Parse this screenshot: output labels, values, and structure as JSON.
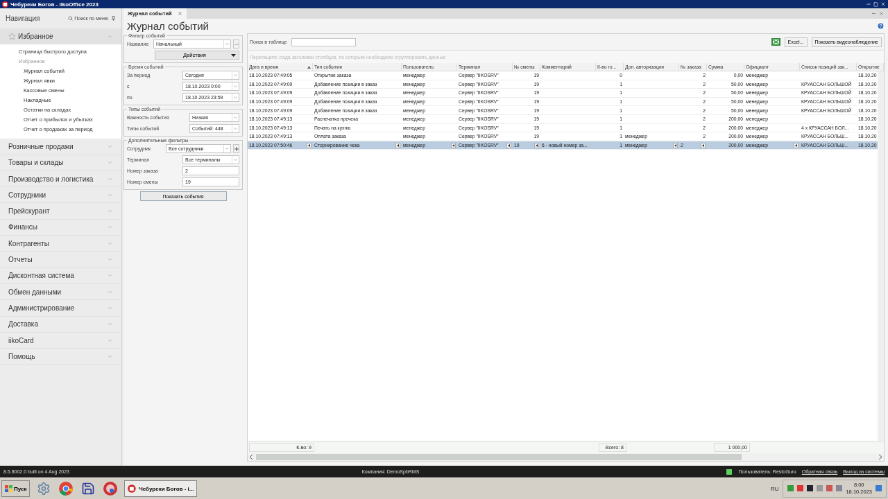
{
  "window": {
    "title": "Чебуреки Богов - iikoOffice 2023"
  },
  "navigation": {
    "title": "Навигация",
    "search": "Поиск по меню",
    "sections": [
      {
        "label": "Избранное",
        "expanded": true,
        "children": [
          {
            "label": "Страница быстрого доступа",
            "kind": "link"
          },
          {
            "label": "Избранное",
            "kind": "group",
            "children": [
              {
                "label": "Журнал событий"
              },
              {
                "label": "Журнал явки"
              },
              {
                "label": "Кассовые смены"
              },
              {
                "label": "Накладные"
              },
              {
                "label": "Остатки на складах"
              },
              {
                "label": "Отчет о прибылях и убытках"
              },
              {
                "label": "Отчет о продажах за период"
              }
            ]
          }
        ]
      },
      {
        "label": "Розничные продажи",
        "expanded": false
      },
      {
        "label": "Товары и склады",
        "expanded": false
      },
      {
        "label": "Производство и логистика",
        "expanded": false
      },
      {
        "label": "Сотрудники",
        "expanded": false
      },
      {
        "label": "Прейскурант",
        "expanded": false
      },
      {
        "label": "Финансы",
        "expanded": false
      },
      {
        "label": "Контрагенты",
        "expanded": false
      },
      {
        "label": "Отчеты",
        "expanded": false
      },
      {
        "label": "Дисконтная система",
        "expanded": false
      },
      {
        "label": "Обмен данными",
        "expanded": false
      },
      {
        "label": "Администрирование",
        "expanded": false
      },
      {
        "label": "Доставка",
        "expanded": false
      },
      {
        "label": "iikoCard",
        "expanded": false
      },
      {
        "label": "Помощь",
        "expanded": false
      }
    ]
  },
  "tabs": [
    {
      "label": "Журнал событий",
      "selected": true
    }
  ],
  "page_title": "Журнал событий",
  "filter": {
    "title": "Фильтр событий",
    "name_label": "Название",
    "name_value": "Начальный",
    "actions": "Действия",
    "groups": [
      {
        "title": "Время событий",
        "rows": [
          {
            "label": "За период",
            "value": "Сегодня",
            "kind": "combo"
          },
          {
            "label": "с",
            "value": "18.10.2023 0:00",
            "kind": "combo"
          },
          {
            "label": "по",
            "value": "18.10.2023 23:59",
            "kind": "combo"
          }
        ]
      },
      {
        "title": "Типы событий",
        "rows": [
          {
            "label": "Важность события",
            "value": "Низкая",
            "kind": "combo"
          },
          {
            "label": "Типы событий",
            "value": "Событий: 448",
            "kind": "combo"
          }
        ]
      },
      {
        "title": "Дополнительные фильтры",
        "rows": [
          {
            "label": "Сотрудник",
            "value": "Все сотрудники",
            "kind": "combo_add"
          },
          {
            "label": "Терминал",
            "value": "Все терминалы",
            "kind": "combo"
          },
          {
            "label": "Номер заказа",
            "value": "2",
            "kind": "text"
          },
          {
            "label": "Номер смены",
            "value": "19",
            "kind": "text"
          }
        ]
      }
    ],
    "show_button": "Показать события"
  },
  "grid": {
    "search_label": "Поиск в таблице",
    "excel_button": "Excel...",
    "video_button": "Показать видеонаблюдение",
    "group_hint": "Перетащите сюда заголовки столбцов, по которым необходимо сгруппировать данные",
    "columns": [
      {
        "label": "Дата и время",
        "kind": "text",
        "sorted": true,
        "filter_button": true
      },
      {
        "label": "Тип события",
        "kind": "text",
        "sorted": false,
        "filter_button": true
      },
      {
        "label": "Пользователь",
        "kind": "text",
        "sorted": false,
        "filter_button": true
      },
      {
        "label": "Терминал",
        "kind": "text",
        "sorted": false,
        "filter_button": true
      },
      {
        "label": "№ смены",
        "kind": "number",
        "sorted": false,
        "filter_button": true
      },
      {
        "label": "Комментарий",
        "kind": "text",
        "sorted": false,
        "filter_button": false
      },
      {
        "label": "К-во го...",
        "kind": "number",
        "sorted": false,
        "filter_button": false
      },
      {
        "label": "Доп. авторизация",
        "kind": "text",
        "sorted": false,
        "filter_button": true
      },
      {
        "label": "№ заказа",
        "kind": "number",
        "sorted": false,
        "filter_button": true
      },
      {
        "label": "Сумма",
        "kind": "number",
        "sorted": false,
        "filter_button": false
      },
      {
        "label": "Официант",
        "kind": "text",
        "sorted": false,
        "filter_button": true
      },
      {
        "label": "Список позиций зак...",
        "kind": "text",
        "sorted": false,
        "filter_button": false
      },
      {
        "label": "Открытие",
        "kind": "text",
        "sorted": false,
        "filter_button": false
      }
    ],
    "rows": [
      {
        "selected": false,
        "cells": [
          "18.10.2023 07:49:05",
          "Открытие заказа",
          "менеджер",
          "Сервер \"IIKOSRV\"",
          "19",
          "",
          "0",
          "",
          "2",
          "0,00",
          "менеджер",
          "",
          "18.10.20"
        ]
      },
      {
        "selected": false,
        "cells": [
          "18.10.2023 07:49:09",
          "Добавление позиции в заказ",
          "менеджер",
          "Сервер \"IIKOSRV\"",
          "19",
          "",
          "1",
          "",
          "2",
          "50,00",
          "менеджер",
          "КРУАССАН БОЛЬШОЙ",
          "18.10.20"
        ]
      },
      {
        "selected": false,
        "cells": [
          "18.10.2023 07:49:09",
          "Добавление позиции в заказ",
          "менеджер",
          "Сервер \"IIKOSRV\"",
          "19",
          "",
          "1",
          "",
          "2",
          "50,00",
          "менеджер",
          "КРУАССАН БОЛЬШОЙ",
          "18.10.20"
        ]
      },
      {
        "selected": false,
        "cells": [
          "18.10.2023 07:49:09",
          "Добавление позиции в заказ",
          "менеджер",
          "Сервер \"IIKOSRV\"",
          "19",
          "",
          "1",
          "",
          "2",
          "50,00",
          "менеджер",
          "КРУАССАН БОЛЬШОЙ",
          "18.10.20"
        ]
      },
      {
        "selected": false,
        "cells": [
          "18.10.2023 07:49:09",
          "Добавление позиции в заказ",
          "менеджер",
          "Сервер \"IIKOSRV\"",
          "19",
          "",
          "1",
          "",
          "2",
          "50,00",
          "менеджер",
          "КРУАССАН БОЛЬШОЙ",
          "18.10.20"
        ]
      },
      {
        "selected": false,
        "cells": [
          "18.10.2023 07:49:13",
          "Распечатка пречека",
          "менеджер",
          "Сервер \"IIKOSRV\"",
          "19",
          "",
          "1",
          "",
          "2",
          "200,00",
          "менеджер",
          "",
          "18.10.20"
        ]
      },
      {
        "selected": false,
        "cells": [
          "18.10.2023 07:49:13",
          "Печать на кухню",
          "менеджер",
          "Сервер \"IIKOSRV\"",
          "19",
          "",
          "1",
          "",
          "2",
          "200,00",
          "менеджер",
          "4 x КРУАССАН БОЛ...",
          "18.10.20"
        ]
      },
      {
        "selected": false,
        "cells": [
          "18.10.2023 07:49:13",
          "Оплата заказа",
          "менеджер",
          "Сервер \"IIKOSRV\"",
          "19",
          "",
          "1",
          "менеджер",
          "2",
          "200,00",
          "менеджер",
          "КРУАССАН БОЛЬШ...",
          "18.10.20"
        ]
      },
      {
        "selected": true,
        "cells": [
          "18.10.2023 07:50:46",
          "Сторнирование чека",
          "менеджер",
          "Сервер \"IIKOSRV\"",
          "19",
          "6 - новый номер за...",
          "1",
          "менеджер",
          "2",
          "200,00",
          "менеджер",
          "КРУАССАН БОЛЬШ...",
          "18.10.20"
        ]
      }
    ],
    "footer": {
      "count": "К-во: 9",
      "total": "Всего: 8",
      "sum": "1 000,00"
    }
  },
  "status_bar": {
    "version": "8.5.8002.0 built on 4 Aug 2023",
    "company": "Компания: DemoSpbRMS",
    "online": true,
    "user": "Пользователь: RestoGuru",
    "links": [
      "Обратная связь",
      "Выход из системы"
    ]
  },
  "taskbar": {
    "start": "Пуск",
    "window": "Чебуреки Богов - i...",
    "language": "RU",
    "time": "8:00",
    "date": "18.10.2023"
  }
}
